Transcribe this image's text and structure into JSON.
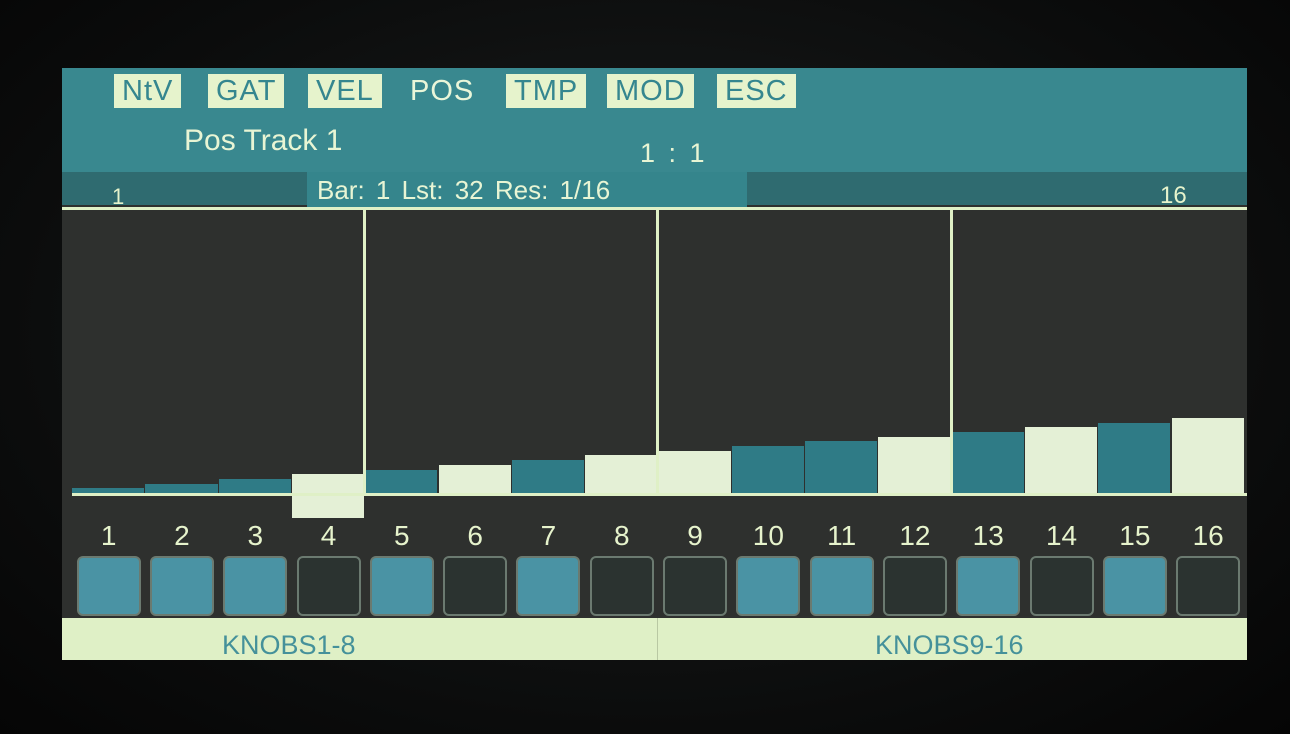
{
  "tabs": [
    {
      "label": "NtV",
      "active": true
    },
    {
      "label": "GAT",
      "active": true
    },
    {
      "label": "VEL",
      "active": true
    },
    {
      "label": "POS",
      "active": false
    },
    {
      "label": "TMP",
      "active": true
    },
    {
      "label": "MOD",
      "active": true
    },
    {
      "label": "ESC",
      "active": true
    }
  ],
  "track_title": "Pos Track 1",
  "position": "1 : 1",
  "info": "Bar: 1 Lst: 32 Res: 1/16",
  "range_start": "1",
  "range_end": "16",
  "colors": {
    "teal_bar": "#2f7b86",
    "light_bar": "#e4f0d6",
    "accent": "#39888f"
  },
  "steps": [
    {
      "number": "1",
      "value": 1,
      "bar_color": "teal",
      "pad": "on"
    },
    {
      "number": "2",
      "value": 2,
      "bar_color": "teal",
      "pad": "on"
    },
    {
      "number": "3",
      "value": 3,
      "bar_color": "teal",
      "pad": "on"
    },
    {
      "number": "4",
      "value": 4,
      "bar_color": "light",
      "pad": "off",
      "selected": true
    },
    {
      "number": "5",
      "value": 5,
      "bar_color": "teal",
      "pad": "on"
    },
    {
      "number": "6",
      "value": 6,
      "bar_color": "light",
      "pad": "off"
    },
    {
      "number": "7",
      "value": 7,
      "bar_color": "teal",
      "pad": "on"
    },
    {
      "number": "8",
      "value": 8,
      "bar_color": "light",
      "pad": "off"
    },
    {
      "number": "9",
      "value": 9,
      "bar_color": "light",
      "pad": "off"
    },
    {
      "number": "10",
      "value": 10,
      "bar_color": "teal",
      "pad": "on"
    },
    {
      "number": "11",
      "value": 11,
      "bar_color": "teal",
      "pad": "on"
    },
    {
      "number": "12",
      "value": 12,
      "bar_color": "light",
      "pad": "off"
    },
    {
      "number": "13",
      "value": 13,
      "bar_color": "teal",
      "pad": "on"
    },
    {
      "number": "14",
      "value": 14,
      "bar_color": "light",
      "pad": "off"
    },
    {
      "number": "15",
      "value": 15,
      "bar_color": "teal",
      "pad": "on"
    },
    {
      "number": "16",
      "value": 16,
      "bar_color": "light",
      "pad": "off"
    }
  ],
  "knob_labels": [
    "KNOBS1-8",
    "KNOBS9-16"
  ]
}
